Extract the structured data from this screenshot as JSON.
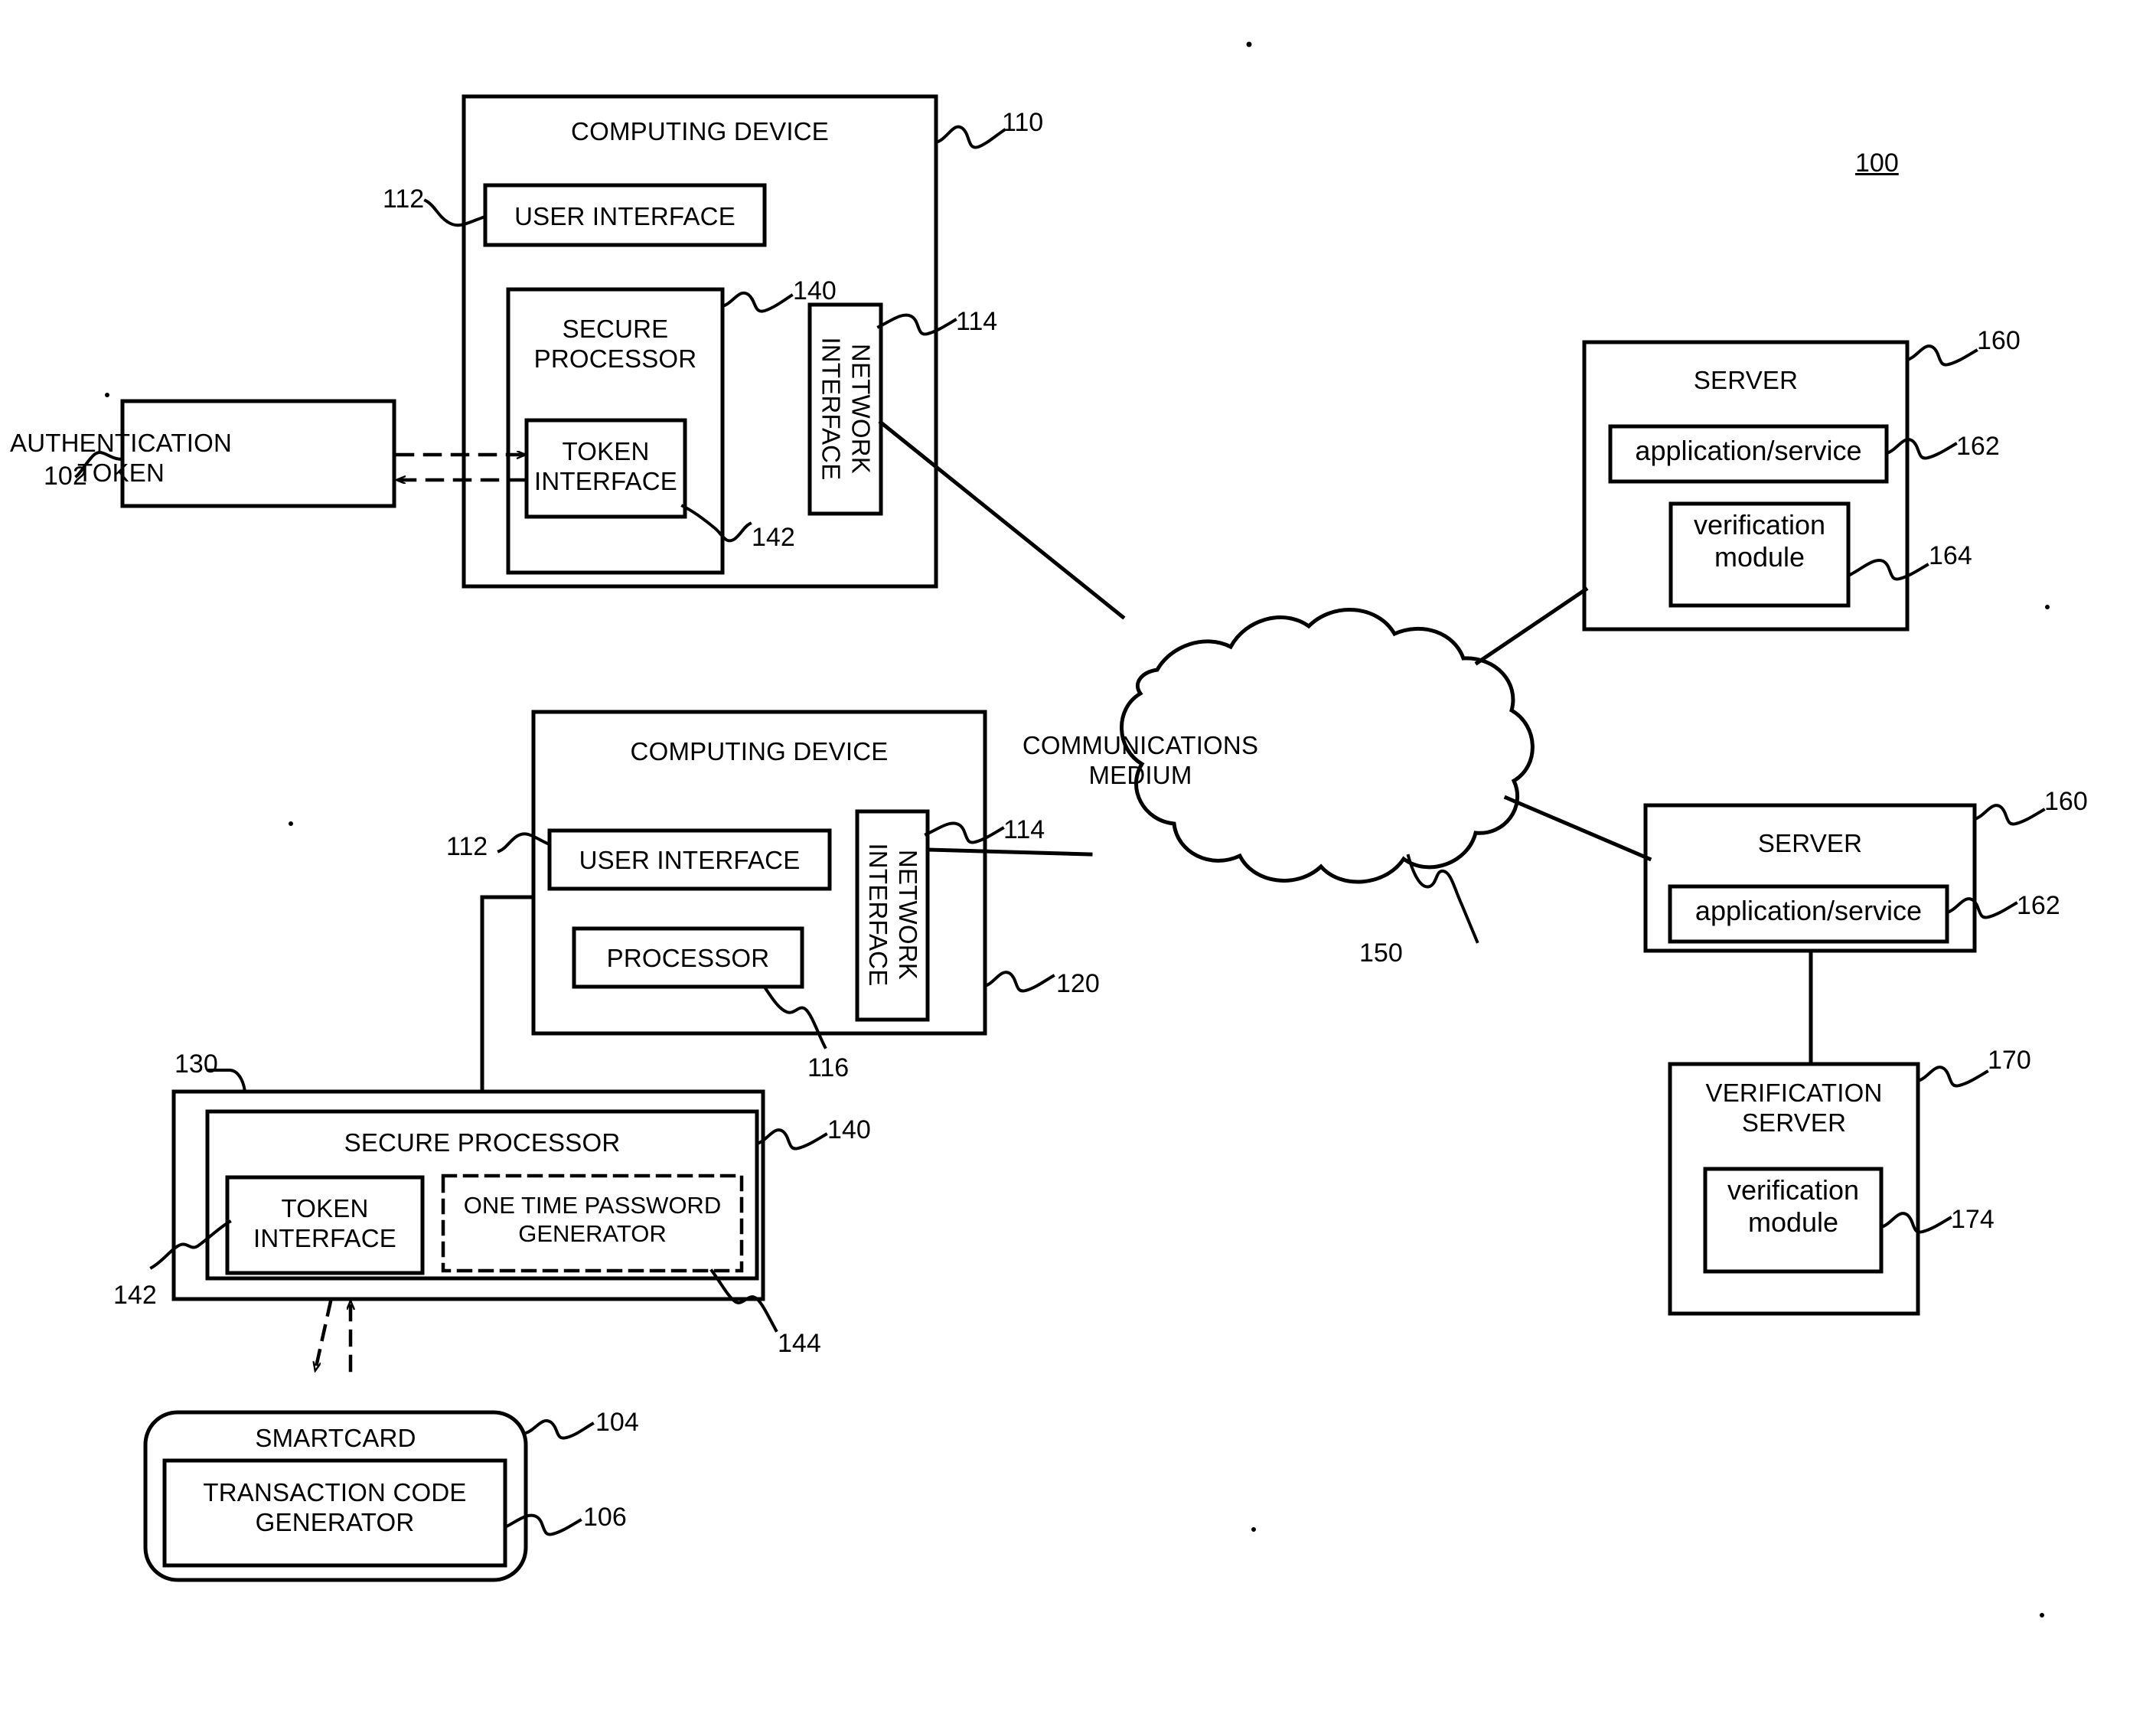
{
  "figure": {
    "figure_numeral": "100",
    "blocks": {
      "auth_token": {
        "title": "AUTHENTICATION\nTOKEN",
        "ref": "102"
      },
      "computing_device_1": {
        "title": "COMPUTING DEVICE",
        "ref": "110"
      },
      "user_interface_1": {
        "title": "USER INTERFACE",
        "ref": "112"
      },
      "secure_processor_1": {
        "title": "SECURE\nPROCESSOR",
        "ref": "140"
      },
      "token_interface_1": {
        "title": "TOKEN\nINTERFACE",
        "ref": "142"
      },
      "network_interface_1": {
        "title": "NETWORK\nINTERFACE",
        "ref": "114"
      },
      "computing_device_2": {
        "title": "COMPUTING DEVICE",
        "ref": "120"
      },
      "user_interface_2": {
        "title": "USER INTERFACE",
        "ref": "112"
      },
      "processor_2": {
        "title": "PROCESSOR",
        "ref": "116"
      },
      "network_interface_2": {
        "title": "NETWORK\nINTERFACE",
        "ref": "114"
      },
      "secure_processor_outer": {
        "ref": "130"
      },
      "secure_processor_2": {
        "title": "SECURE PROCESSOR",
        "ref": "140"
      },
      "token_interface_2": {
        "title": "TOKEN\nINTERFACE",
        "ref": "142"
      },
      "otp_generator": {
        "title": "ONE TIME PASSWORD\nGENERATOR",
        "ref": "144"
      },
      "smartcard": {
        "title": "SMARTCARD",
        "ref": "104"
      },
      "transaction_code_generator": {
        "title": "TRANSACTION CODE\nGENERATOR",
        "ref": "106"
      },
      "communications_medium": {
        "title": "COMMUNICATIONS\nMEDIUM",
        "ref": "150"
      },
      "server_1": {
        "title": "SERVER",
        "ref": "160"
      },
      "application_service_1": {
        "title": "application/service",
        "ref": "162"
      },
      "verification_module_1": {
        "title": "verification\nmodule",
        "ref": "164"
      },
      "server_2": {
        "title": "SERVER",
        "ref": "160"
      },
      "application_service_2": {
        "title": "application/service",
        "ref": "162"
      },
      "verification_server": {
        "title": "VERIFICATION\nSERVER",
        "ref": "170"
      },
      "verification_module_2": {
        "title": "verification\nmodule",
        "ref": "174"
      }
    },
    "colors": {
      "ink": "#000000",
      "paper": "#ffffff"
    }
  }
}
